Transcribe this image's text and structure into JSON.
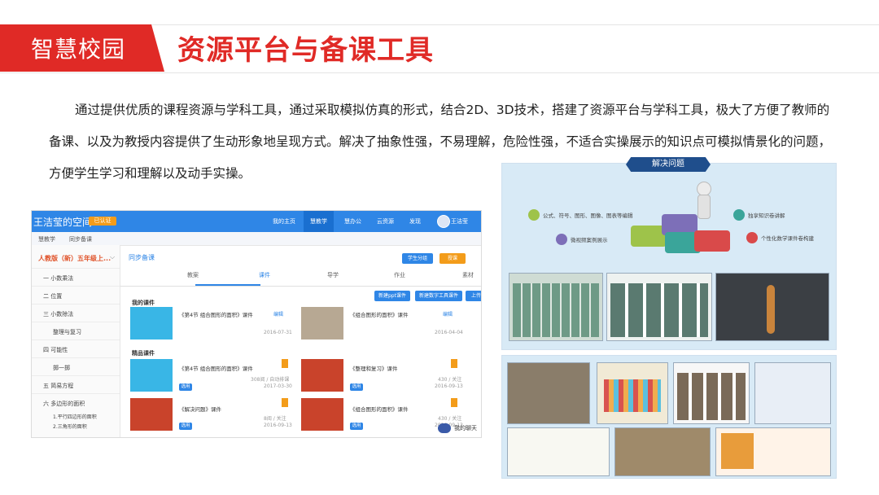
{
  "header": {
    "section_tag": "智慧校园",
    "title": "资源平台与备课工具"
  },
  "intro": "通过提供优质的课程资源与学科工具，通过采取模拟仿真的形式，结合2D、3D技术，搭建了资源平台与学科工具，极大了方便了教师的备课、以及为教授内容提供了生动形象地呈现方式。解决了抽象性强，不易理解，危险性强，不适合实操展示的知识点可模拟情景化的问题，方便学生学习和理解以及动手实操。",
  "screenshot": {
    "brand": "王洁莹的空间",
    "badge": "已认证",
    "nav": [
      "我的主页",
      "慧教学",
      "慧办公",
      "云资源",
      "发现"
    ],
    "user": "王洁莹",
    "subnav": [
      "慧教学",
      "同步备课"
    ],
    "grade": "人教版（新）五年级上...",
    "sidebar": [
      "一 小数乘法",
      "二 位置",
      "三 小数除法",
      "整理与复习",
      "四 可能性",
      "掷一掷",
      "五 简易方程",
      "六 多边形的面积",
      "1.平行四边形的面积",
      "2.三角形的面积"
    ],
    "breadcrumb": "同步备课",
    "top_buttons": [
      "学生分组",
      "授课"
    ],
    "tabs": [
      "教案",
      "课件",
      "导学",
      "作业",
      "素材"
    ],
    "my_label": "我的课件",
    "new_buttons": [
      "新建ppt课件",
      "新建数字工具课件",
      "上传课件"
    ],
    "my_cards": [
      {
        "title": "《第4节 组合图形的面积》课件",
        "date": "2016-07-31",
        "action": "编辑"
      },
      {
        "title": "《组合图形的面积》课件",
        "date": "2016-04-04",
        "action": "编辑"
      }
    ],
    "featured_label": "精品课件",
    "featured_cards": [
      {
        "title": "《第4节 组合图形的面积》课件",
        "meta": "308阅 / 自动排课",
        "date": "2017-03-30",
        "tag": "选用"
      },
      {
        "title": "《整理和复习》课件",
        "meta": "430 / 关注",
        "date": "2016-09-13",
        "tag": "选用"
      },
      {
        "title": "《解决问题》课件",
        "meta": "8阅 / 关注",
        "date": "2016-09-13",
        "tag": "选用"
      },
      {
        "title": "《组合图形的面积》课件",
        "meta": "430 / 关注",
        "date": "2016-09-13",
        "tag": "选用"
      }
    ],
    "chat": "我的聊天"
  },
  "right_panel": {
    "ribbon": "解决问题",
    "nodes": [
      "公式、符号、图形、图像、图表等编辑",
      "微视频案例展示",
      "独享知识卷讲解",
      "个性化数学课件卷构建"
    ],
    "colors": {
      "green": "#9ec34a",
      "purple": "#7d6fb8",
      "teal": "#3aa59a",
      "red": "#d94a4a"
    }
  }
}
